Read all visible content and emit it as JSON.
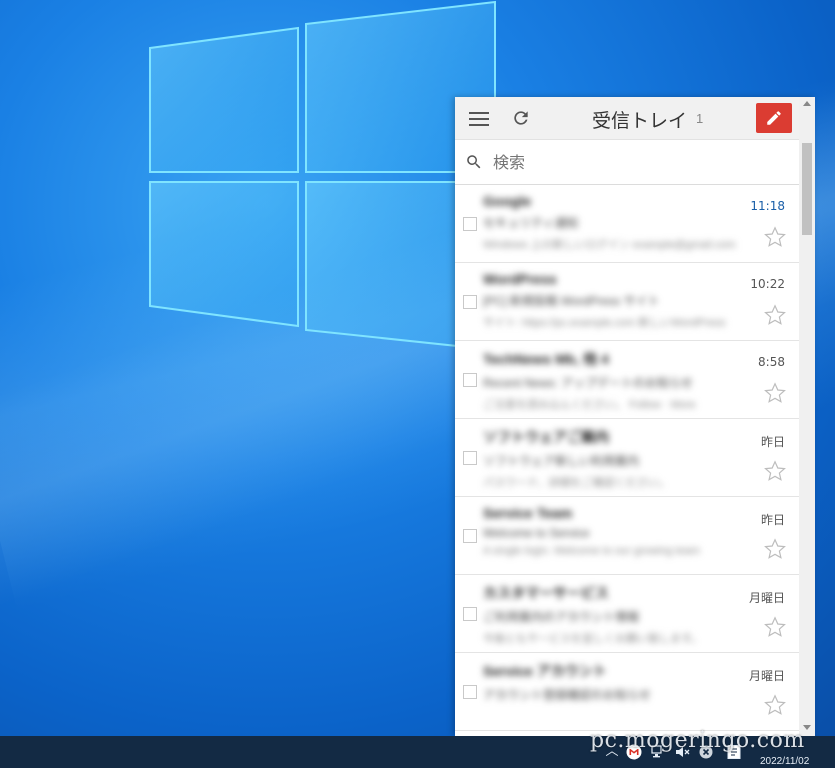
{
  "popup": {
    "title": "受信トレイ",
    "unread_count": "1",
    "search_placeholder": "検索",
    "colors": {
      "compose": "#db3c32",
      "unread_time": "#1a5fa8"
    }
  },
  "mails": [
    {
      "sender": "Google",
      "subject": "セキュリティ通知",
      "snippet": "Windows 上の新しいログイン example@gmail.com",
      "time": "11:18",
      "unread": true
    },
    {
      "sender": "WordPress",
      "subject": "[PC] 新規投稿 WordPress サイト",
      "snippet": "サイト: https://pc.example.com 新しいWordPress",
      "time": "10:22",
      "unread": false
    },
    {
      "sender": "TechNews Mb, 他 4",
      "subject": "Recent News: アップデートのお知らせ",
      "snippet": "ご注意を読み込んください。 Follow · More",
      "time": "8:58",
      "unread": false
    },
    {
      "sender": "ソフトウェアご案内",
      "subject": "ソフトウェア新しい利用案内",
      "snippet": "パスワード、詳細をご確認ください。",
      "time": "昨日",
      "unread": false
    },
    {
      "sender": "Service Team",
      "subject": "Welcome to Service",
      "snippet": "A single login. Welcome to our growing team",
      "time": "昨日",
      "unread": false
    },
    {
      "sender": "カスタマーサービス",
      "subject": "ご利用案内のアカウント情報",
      "snippet": "今後ともサービスを宜しくお願い致します。",
      "time": "月曜日",
      "unread": false
    },
    {
      "sender": "Service アカウント",
      "subject": "アカウント登録確認のお知らせ",
      "snippet": "",
      "time": "月曜日",
      "unread": false
    }
  ],
  "taskbar": {
    "icons": [
      "chevron-up-icon",
      "gmail-icon",
      "network-icon",
      "volume-muted-icon",
      "close-circle-icon",
      "notepad-icon"
    ],
    "date": "2022/11/02",
    "watermark": "pc.mogeringo.com"
  }
}
